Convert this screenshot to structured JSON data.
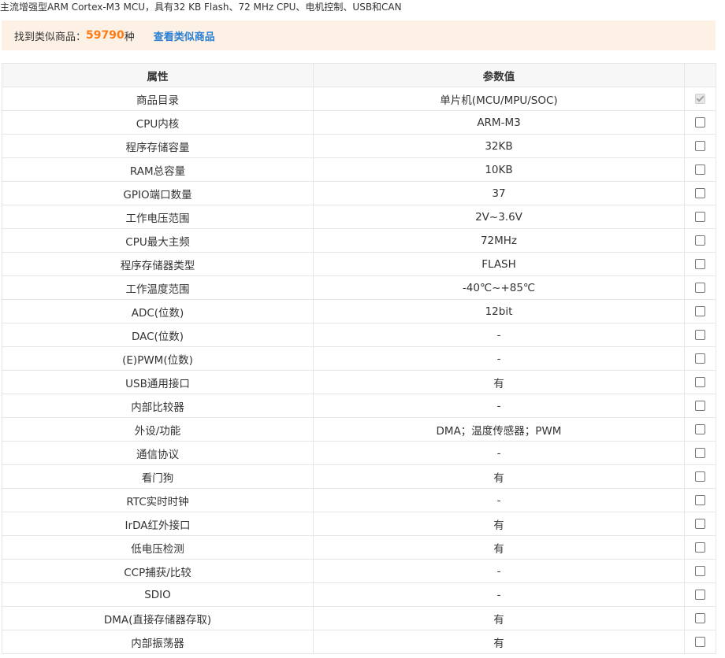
{
  "description": "主流增强型ARM Cortex-M3 MCU，具有32 KB Flash、72 MHz CPU、电机控制、USB和CAN",
  "found": {
    "prefix": "找到类似商品：",
    "count": "59790",
    "suffix": "种",
    "link_label": "查看类似商品",
    "count_color": "#ff7a12",
    "link_color": "#2a7fd4"
  },
  "table": {
    "headers": [
      "属性",
      "参数值",
      ""
    ],
    "rows": [
      {
        "attr": "商品目录",
        "value": "单片机(MCU/MPU/SOC)",
        "checked": true,
        "disabled": true
      },
      {
        "attr": "CPU内核",
        "value": "ARM-M3",
        "checked": false,
        "disabled": false
      },
      {
        "attr": "程序存储容量",
        "value": "32KB",
        "checked": false,
        "disabled": false
      },
      {
        "attr": "RAM总容量",
        "value": "10KB",
        "checked": false,
        "disabled": false
      },
      {
        "attr": "GPIO端口数量",
        "value": "37",
        "checked": false,
        "disabled": false
      },
      {
        "attr": "工作电压范围",
        "value": "2V~3.6V",
        "checked": false,
        "disabled": false
      },
      {
        "attr": "CPU最大主频",
        "value": "72MHz",
        "checked": false,
        "disabled": false
      },
      {
        "attr": "程序存储器类型",
        "value": "FLASH",
        "checked": false,
        "disabled": false
      },
      {
        "attr": "工作温度范围",
        "value": "-40℃~+85℃",
        "checked": false,
        "disabled": false
      },
      {
        "attr": "ADC(位数)",
        "value": "12bit",
        "checked": false,
        "disabled": false
      },
      {
        "attr": "DAC(位数)",
        "value": "-",
        "checked": false,
        "disabled": false
      },
      {
        "attr": "(E)PWM(位数)",
        "value": "-",
        "checked": false,
        "disabled": false
      },
      {
        "attr": "USB通用接口",
        "value": "有",
        "checked": false,
        "disabled": false
      },
      {
        "attr": "内部比较器",
        "value": "-",
        "checked": false,
        "disabled": false
      },
      {
        "attr": "外设/功能",
        "value": "DMA；温度传感器；PWM",
        "checked": false,
        "disabled": false
      },
      {
        "attr": "通信协议",
        "value": "-",
        "checked": false,
        "disabled": false
      },
      {
        "attr": "看门狗",
        "value": "有",
        "checked": false,
        "disabled": false
      },
      {
        "attr": "RTC实时时钟",
        "value": "-",
        "checked": false,
        "disabled": false
      },
      {
        "attr": "IrDA红外接口",
        "value": "有",
        "checked": false,
        "disabled": false
      },
      {
        "attr": "低电压检测",
        "value": "有",
        "checked": false,
        "disabled": false
      },
      {
        "attr": "CCP捕获/比较",
        "value": "-",
        "checked": false,
        "disabled": false
      },
      {
        "attr": "SDIO",
        "value": "-",
        "checked": false,
        "disabled": false
      },
      {
        "attr": "DMA(直接存储器存取)",
        "value": "有",
        "checked": false,
        "disabled": false
      },
      {
        "attr": "内部振荡器",
        "value": "有",
        "checked": false,
        "disabled": false
      }
    ]
  }
}
